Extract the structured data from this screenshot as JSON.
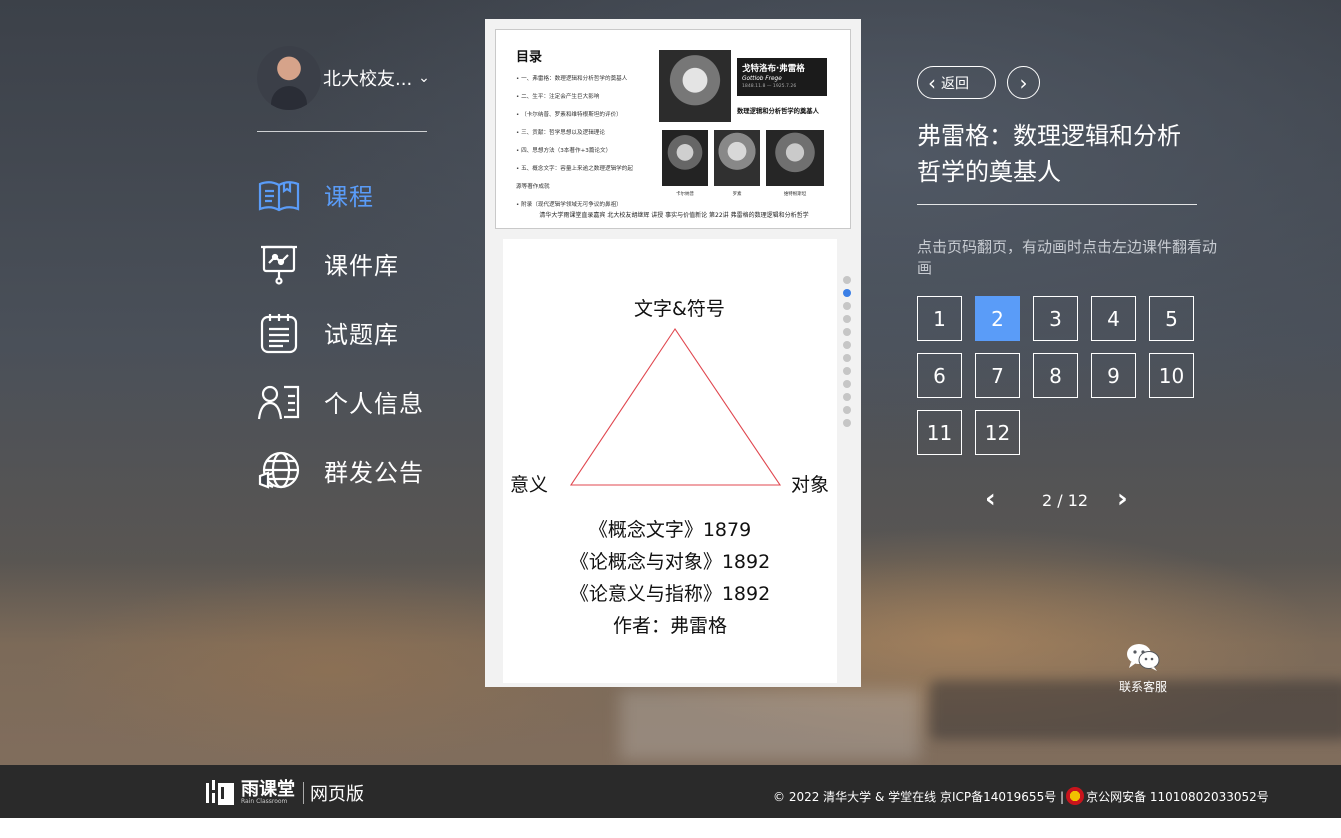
{
  "user": {
    "name": "北大校友...",
    "caret": "⌄"
  },
  "sidebar": {
    "items": [
      {
        "label": "课程",
        "icon": "book-icon",
        "active": true
      },
      {
        "label": "课件库",
        "icon": "presentation-board-icon",
        "active": false
      },
      {
        "label": "试题库",
        "icon": "notepad-icon",
        "active": false
      },
      {
        "label": "个人信息",
        "icon": "user-card-icon",
        "active": false
      },
      {
        "label": "群发公告",
        "icon": "globe-broadcast-icon",
        "active": false
      }
    ]
  },
  "viewer": {
    "slide1": {
      "title": "目录",
      "toc": [
        "• 一、弗雷格：数理逻辑和分析哲学的奠基人",
        "• 二、生平：注定会产生巨大影响",
        "• （卡尔纳普、罗素和维特根斯坦的评价）",
        "• 三、贡献：哲学思想以及逻辑理论",
        "• 四、思想方法（3本著作+3篇论文）",
        "• 五、概念文字：容量上来逾之数理逻辑学的起",
        "  源等著作成就",
        "• 附录（现代逻辑学领域无可争议的鼻祖）"
      ],
      "name_cn": "戈特洛布·弗雷格",
      "name_en": "Gottlob Frege",
      "dates": "1848.11.8 — 1925.7.26",
      "subtitle": "数理逻辑和分析哲学的奠基人",
      "captions": [
        "卡尔纳普",
        "罗素",
        "维特根斯坦"
      ],
      "footer": "清华大学雨课堂直录嘉宾 北大校友胡继辉 讲授 事实与价值新论 第22讲 弗雷格的数理逻辑和分析哲学"
    },
    "slide2": {
      "top": "文字&符号",
      "left": "意义",
      "right": "对象",
      "lines": [
        "《概念文字》1879",
        "《论概念与对象》1892",
        "《论意义与指称》1892",
        "作者：弗雷格"
      ]
    },
    "dots_total": 12,
    "dots_active": 2
  },
  "panel": {
    "back_label": "返回",
    "title": "弗雷格：数理逻辑和分析哲学的奠基人",
    "hint": "点击页码翻页，有动画时点击左边课件翻看动画",
    "pages": [
      "1",
      "2",
      "3",
      "4",
      "5",
      "6",
      "7",
      "8",
      "9",
      "10",
      "11",
      "12"
    ],
    "active_page": "2",
    "counter": "2 / 12",
    "service_label": "联系客服"
  },
  "footer": {
    "brand_name": "雨课堂",
    "brand_en": "Rain Classroom",
    "web_label": "网页版",
    "copyright_left": "© 2022 清华大学 & 学堂在线 京ICP备14019655号 |",
    "copyright_right": "京公网安备 11010802033052号"
  },
  "colors": {
    "accent": "#5a9cf8",
    "active_dot": "#3b7fe6",
    "footer_bg": "#2a2a2a",
    "triangle": "#e0474f"
  }
}
